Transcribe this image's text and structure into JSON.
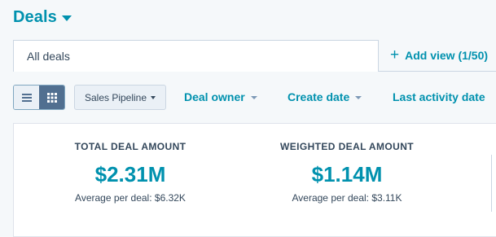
{
  "header": {
    "title": "Deals"
  },
  "tabs": {
    "active_label": "All deals",
    "add_view_label": "Add view (1/50)"
  },
  "toolbar": {
    "view_modes": [
      "list",
      "board"
    ],
    "active_view": "board",
    "pipeline_label": "Sales Pipeline",
    "filters": [
      "Deal owner",
      "Create date",
      "Last activity date"
    ]
  },
  "summary": {
    "metrics": [
      {
        "label": "TOTAL DEAL AMOUNT",
        "value": "$2.31M",
        "average": "Average per deal: $6.32K"
      },
      {
        "label": "WEIGHTED DEAL AMOUNT",
        "value": "$1.14M",
        "average": "Average per deal: $3.11K"
      }
    ]
  },
  "colors": {
    "accent": "#0091ae",
    "text": "#33475b",
    "background": "#f5f8fa",
    "active_toggle": "#516f90"
  }
}
